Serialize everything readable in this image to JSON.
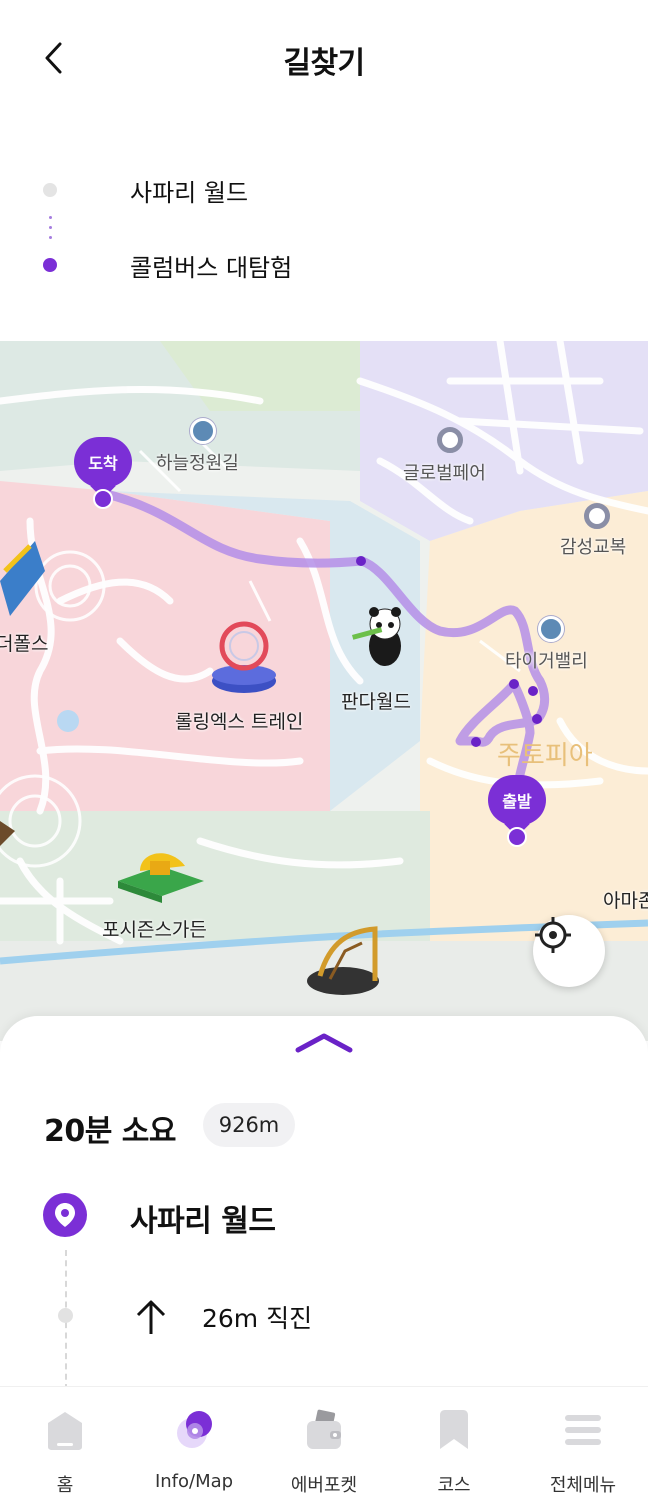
{
  "header": {
    "title": "길찾기"
  },
  "route": {
    "from": "사파리 월드",
    "to": "콜럼버스 대탐험"
  },
  "map": {
    "labels": {
      "haneul": "하늘정원길",
      "global_fair": "글로벌페어",
      "gamseong": "감성교복",
      "tiger_valley": "타이거밸리",
      "dupols": "더폴스",
      "rolling_x": "롤링엑스 트레인",
      "panda_world": "판다월드",
      "zootopia": "주토피아",
      "four_seasons": "포시즌스가든",
      "amazon": "아마존"
    },
    "pins": {
      "arrival": "도착",
      "departure": "출발"
    },
    "colors": {
      "route": "#b48ee8",
      "pin": "#7b2fd6"
    }
  },
  "sheet": {
    "duration": "20분 소요",
    "distance": "926m",
    "start_label": "사파리 월드",
    "steps": [
      {
        "icon": "arrow-up-icon",
        "text": "26m 직진"
      }
    ]
  },
  "tabbar": {
    "items": [
      {
        "label": "홈",
        "icon": "home-icon"
      },
      {
        "label": "Info/Map",
        "icon": "map-info-icon",
        "active": true
      },
      {
        "label": "에버포켓",
        "icon": "wallet-icon"
      },
      {
        "label": "코스",
        "icon": "bookmark-icon"
      },
      {
        "label": "전체메뉴",
        "icon": "menu-icon"
      }
    ]
  }
}
